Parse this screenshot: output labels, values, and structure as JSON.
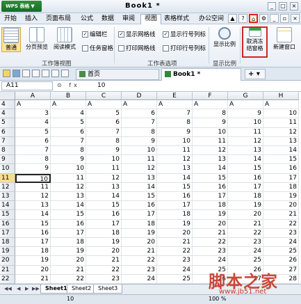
{
  "app": {
    "name": "WPS 表格",
    "doc_title": "Book1 *"
  },
  "menu": [
    "开始",
    "插入",
    "页面布局",
    "公式",
    "数据",
    "审阅",
    "视图",
    "表格样式",
    "办公空间"
  ],
  "menu_active": "视图",
  "ribbon": {
    "view_modes": [
      "普通",
      "分页预览",
      "阅读模式"
    ],
    "workbook_view_label": "工作簿视图",
    "checks_left": [
      {
        "label": "编辑栏",
        "checked": true
      },
      {
        "label": "任务窗格",
        "checked": false
      }
    ],
    "checks_mid": [
      {
        "label": "显示网格线",
        "checked": true
      },
      {
        "label": "打印网格线",
        "checked": false
      },
      {
        "label": "显示行号列标",
        "checked": true
      },
      {
        "label": "打印行号列标",
        "checked": false
      }
    ],
    "sheet_options_label": "工作表选项",
    "zoom_btn": "显示比例",
    "zoom_label": "显示比例",
    "freeze_btn": "取消冻结窗格",
    "new_window_btn": "新建窗口"
  },
  "tabs": {
    "home": "首页",
    "book": "Book1 *",
    "add": "+ ▾"
  },
  "formula": {
    "name_box": "A11",
    "value": "10",
    "fx": "⊙ fx"
  },
  "columns": [
    "A",
    "B",
    "C",
    "D",
    "E",
    "F",
    "G",
    "H"
  ],
  "first_row": {
    "row": "4",
    "values": [
      "A",
      "A",
      "A",
      "A",
      "A",
      "A",
      "A",
      "A"
    ]
  },
  "rows": [
    {
      "row": "4",
      "values": [
        "3",
        "4",
        "5",
        "6",
        "7",
        "8",
        "9",
        "10"
      ]
    },
    {
      "row": "5",
      "values": [
        "4",
        "5",
        "6",
        "7",
        "8",
        "9",
        "10",
        "11"
      ]
    },
    {
      "row": "6",
      "values": [
        "5",
        "6",
        "7",
        "8",
        "9",
        "10",
        "11",
        "12"
      ]
    },
    {
      "row": "7",
      "values": [
        "6",
        "7",
        "8",
        "9",
        "10",
        "11",
        "12",
        "13"
      ]
    },
    {
      "row": "8",
      "values": [
        "7",
        "8",
        "9",
        "10",
        "11",
        "12",
        "13",
        "14"
      ]
    },
    {
      "row": "9",
      "values": [
        "8",
        "9",
        "10",
        "11",
        "12",
        "13",
        "14",
        "15"
      ]
    },
    {
      "row": "10",
      "values": [
        "9",
        "10",
        "11",
        "12",
        "13",
        "14",
        "15",
        "16"
      ]
    },
    {
      "row": "11",
      "values": [
        "10",
        "11",
        "12",
        "13",
        "14",
        "15",
        "16",
        "17"
      ]
    },
    {
      "row": "12",
      "values": [
        "11",
        "12",
        "13",
        "14",
        "15",
        "16",
        "17",
        "18"
      ]
    },
    {
      "row": "13",
      "values": [
        "12",
        "13",
        "14",
        "15",
        "16",
        "17",
        "18",
        "19"
      ]
    },
    {
      "row": "14",
      "values": [
        "13",
        "14",
        "15",
        "16",
        "17",
        "18",
        "19",
        "20"
      ]
    },
    {
      "row": "15",
      "values": [
        "14",
        "15",
        "16",
        "17",
        "18",
        "19",
        "20",
        "21"
      ]
    },
    {
      "row": "16",
      "values": [
        "15",
        "16",
        "17",
        "18",
        "19",
        "20",
        "21",
        "22"
      ]
    },
    {
      "row": "17",
      "values": [
        "16",
        "17",
        "18",
        "19",
        "20",
        "21",
        "22",
        "23"
      ]
    },
    {
      "row": "18",
      "values": [
        "17",
        "18",
        "19",
        "20",
        "21",
        "22",
        "23",
        "24"
      ]
    },
    {
      "row": "19",
      "values": [
        "18",
        "19",
        "20",
        "21",
        "22",
        "23",
        "24",
        "25"
      ]
    },
    {
      "row": "20",
      "values": [
        "19",
        "20",
        "21",
        "22",
        "23",
        "24",
        "25",
        "26"
      ]
    },
    {
      "row": "21",
      "values": [
        "20",
        "21",
        "22",
        "23",
        "24",
        "25",
        "26",
        "27"
      ]
    },
    {
      "row": "22",
      "values": [
        "21",
        "22",
        "23",
        "24",
        "25",
        "26",
        "27",
        "28"
      ]
    }
  ],
  "sheets": [
    "Sheet1",
    "Sheet2",
    "Sheet3"
  ],
  "status": {
    "value": "10",
    "zoom": "100 %"
  },
  "watermark": {
    "text": "脚本之家",
    "url": "www.jb51.net"
  },
  "colors": {
    "accent": "#1f7a2e",
    "highlight": "#d42222"
  }
}
